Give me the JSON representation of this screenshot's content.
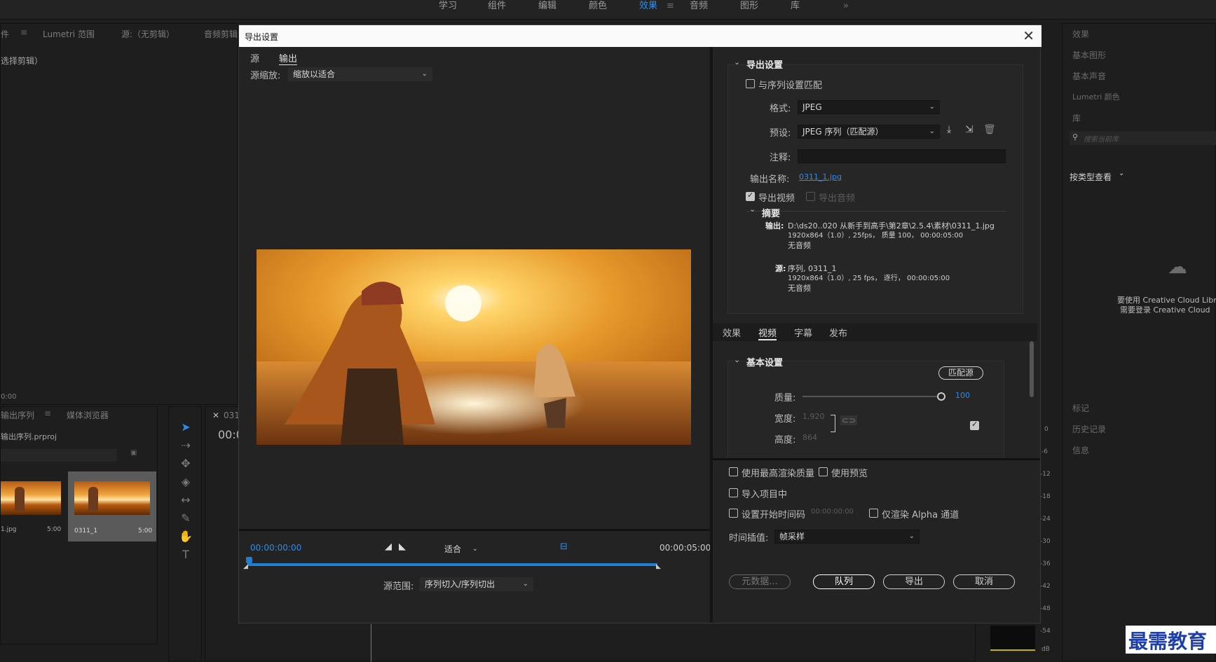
{
  "workspace_tabs": [
    "学习",
    "组件",
    "编辑",
    "颜色",
    "效果",
    "音频",
    "图形",
    "库"
  ],
  "workspace_active": "效果",
  "workspace_more": "»",
  "left_top_tabs": [
    "件",
    "Lumetri 范围",
    "源:（无剪辑）",
    "音频剪辑"
  ],
  "left_top_content": "选择剪辑）",
  "left_top_timecode": "0:00",
  "project": {
    "tabs": [
      "输出序列",
      "媒体浏览器"
    ],
    "file": "输出序列.prproj",
    "items": [
      {
        "name": "1.jpg",
        "duration": "5:00"
      },
      {
        "name": "0311_1",
        "duration": "5:00"
      }
    ]
  },
  "timeline": {
    "tab": "0311",
    "timecode": "00:0"
  },
  "right_panel": {
    "items": [
      "效果",
      "基本图形",
      "基本声音",
      "Lumetri 颜色",
      "库"
    ],
    "search_placeholder": "搜索当前库",
    "view_by": "按类型查看",
    "cc_line1": "要使用 Creative Cloud Libr",
    "cc_line2": "需要登录 Creative Cloud",
    "bottom_items": [
      "标记",
      "历史记录",
      "信息"
    ],
    "meter_ticks": [
      "0",
      "-6",
      "-12",
      "-18",
      "-24",
      "-30",
      "-36",
      "-42",
      "-48",
      "-54",
      "dB"
    ]
  },
  "dialog": {
    "title": "导出设置",
    "close": "✕",
    "tabs": [
      "源",
      "输出"
    ],
    "active_tab": "输出",
    "source_scale_label": "源缩放:",
    "source_scale_value": "缩放以适合",
    "timecode_start": "00:00:00:00",
    "timecode_end": "00:00:05:00",
    "fit_value": "适合",
    "source_range_label": "源范围:",
    "source_range_value": "序列切入/序列切出",
    "export_settings": {
      "heading": "导出设置",
      "match_sequence": "与序列设置匹配",
      "format_label": "格式:",
      "format_value": "JPEG",
      "preset_label": "预设:",
      "preset_value": "JPEG 序列（匹配源）",
      "comment_label": "注释:",
      "output_name_label": "输出名称:",
      "output_name_value": "0311_1.jpg",
      "export_video": "导出视频",
      "export_audio": "导出音频",
      "summary_heading": "摘要",
      "output_key": "输出:",
      "output_path": "D:\\ds20..020 从新手到高手\\第2章\\2.5.4\\素材\\0311_1.jpg",
      "output_spec": "1920x864（1.0）, 25fps， 质量 100， 00:00:05:00",
      "output_audio": "无音频",
      "source_key": "源:",
      "source_name": "序列, 0311_1",
      "source_spec": "1920x864（1.0）, 25 fps， 逐行， 00:00:05:00",
      "source_audio": "无音频"
    },
    "sub_tabs": [
      "效果",
      "视频",
      "字幕",
      "发布"
    ],
    "active_sub_tab": "视频",
    "basic": {
      "heading": "基本设置",
      "match_source_btn": "匹配源",
      "quality_label": "质量:",
      "quality_value": "100",
      "quality_fraction": 1.0,
      "width_label": "宽度:",
      "width_value": "1,920",
      "height_label": "高度:",
      "height_value": "864"
    },
    "bottom": {
      "max_render": "使用最高渲染质量",
      "use_previews": "使用预览",
      "import_project": "导入项目中",
      "set_start_tc": "设置开始时间码",
      "start_tc_value": "00:00:00:00",
      "alpha_only": "仅渲染 Alpha 通道",
      "interp_label": "时间插值:",
      "interp_value": "帧采样",
      "metadata_btn": "元数据...",
      "queue_btn": "队列",
      "export_btn": "导出",
      "cancel_btn": "取消"
    }
  },
  "watermark": "最需教育",
  "colors": {
    "accent": "#2d8ceb",
    "dialog_bg": "#232323",
    "title_bg": "#fafafa"
  }
}
